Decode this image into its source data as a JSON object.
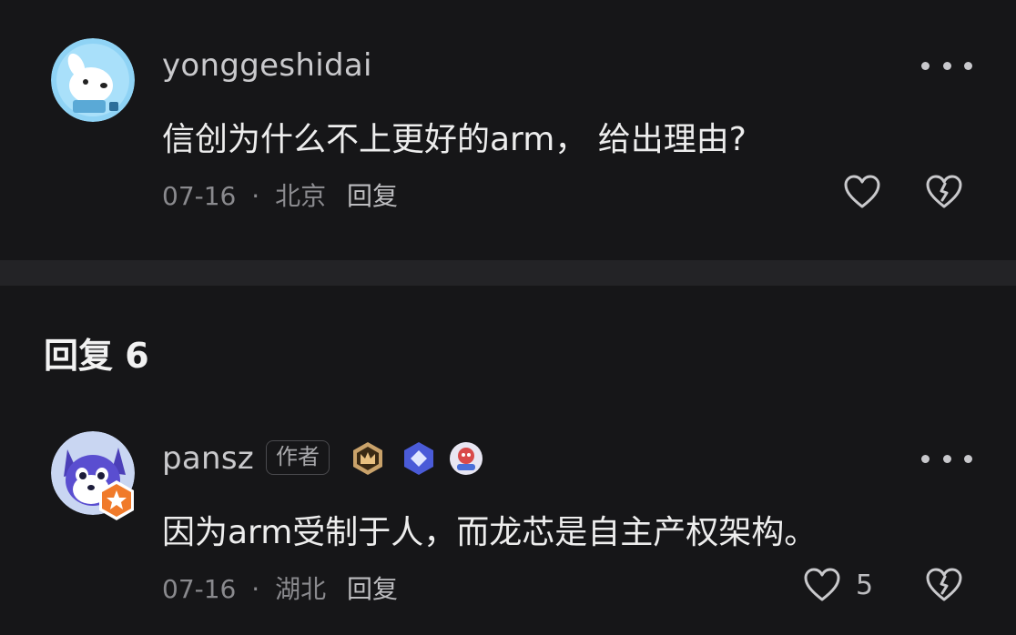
{
  "comment1": {
    "username": "yonggeshidai",
    "text": "信创为什么不上更好的arm， 给出理由?",
    "date": "07-16",
    "separator": "·",
    "location": "北京",
    "reply_label": "回复"
  },
  "replies_section": {
    "title": "回复 6"
  },
  "comment2": {
    "username": "pansz",
    "author_tag": "作者",
    "text": "因为arm受制于人，而龙芯是自主产权架构。",
    "date": "07-16",
    "separator": "·",
    "location": "湖北",
    "reply_label": "回复",
    "like_count": "5"
  },
  "icons": {
    "more": "more-dots-icon",
    "like": "heart-outline-icon",
    "dislike": "broken-heart-icon",
    "badges": [
      "crown-badge-icon",
      "diamond-badge-icon",
      "character-badge-icon"
    ]
  },
  "colors": {
    "background": "#161618",
    "divider": "#232326",
    "text_primary": "#ededed",
    "text_secondary": "#8a8a8e"
  }
}
